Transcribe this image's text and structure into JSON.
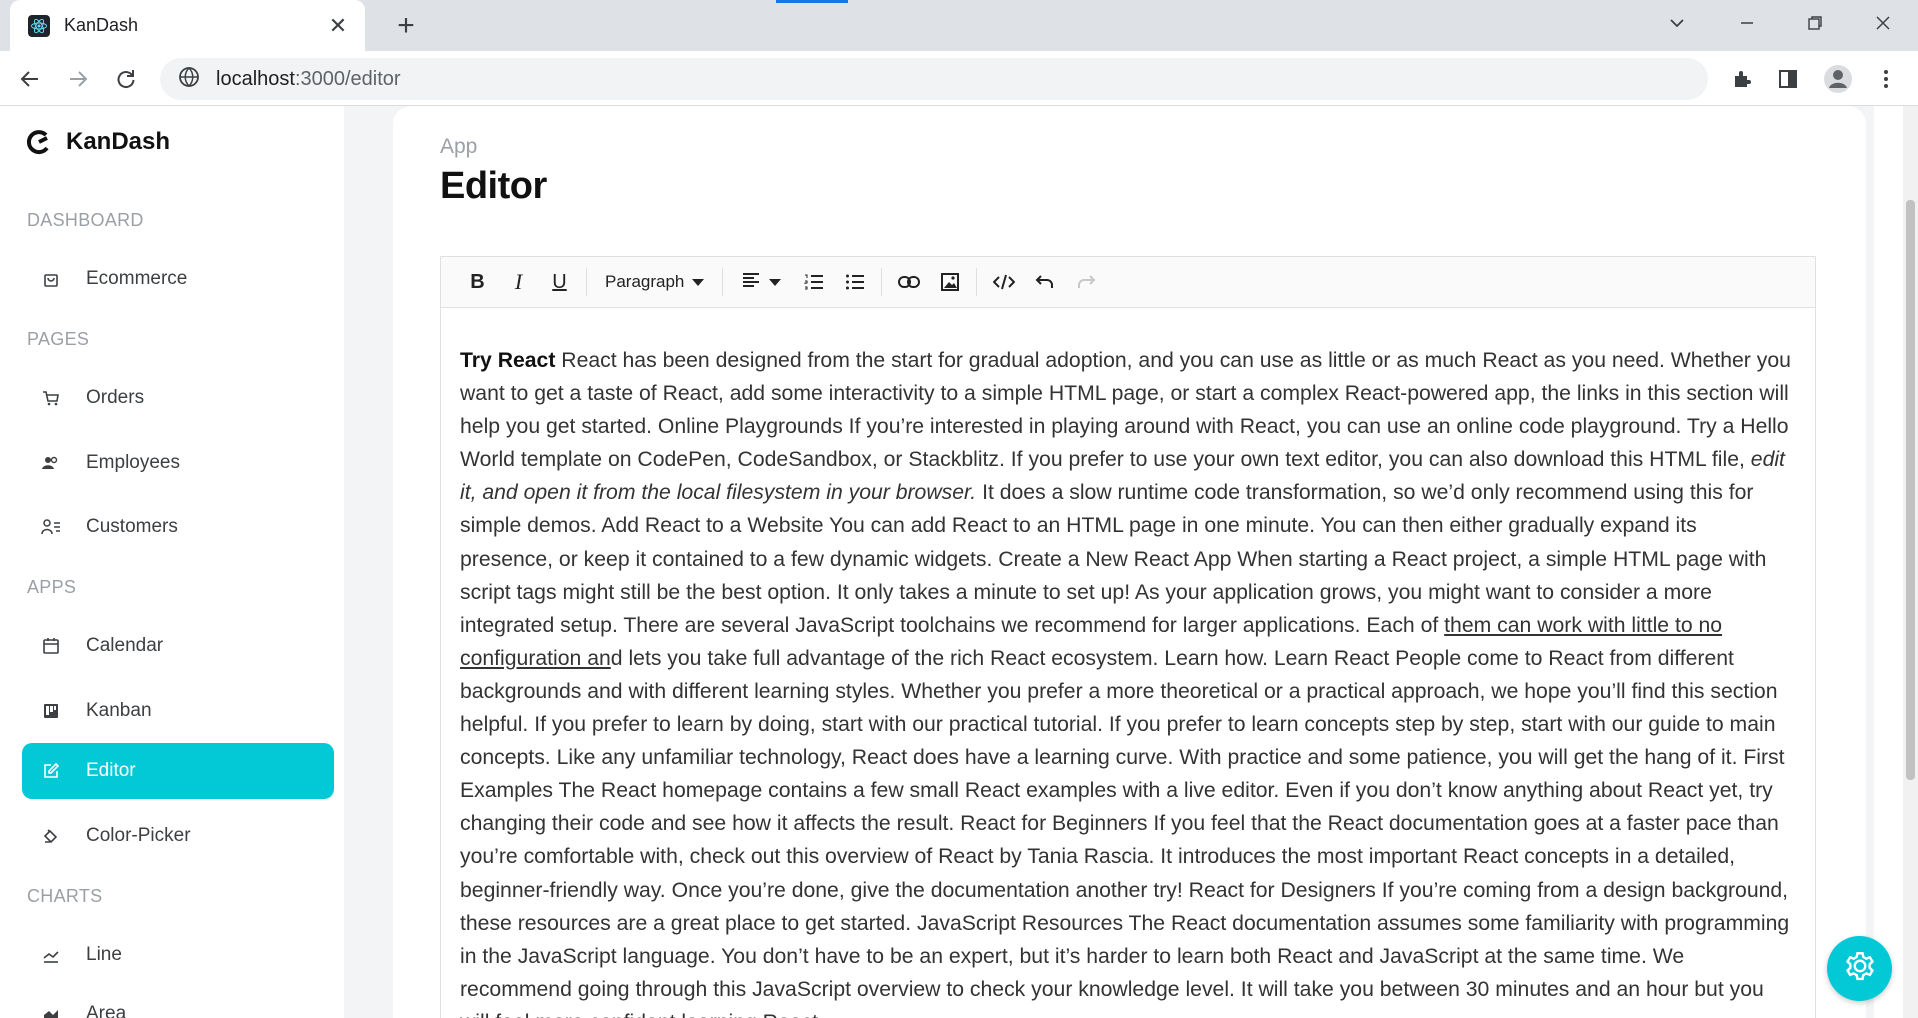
{
  "browser": {
    "tab_title": "KanDash",
    "url_host": "localhost",
    "url_path": ":3000/editor"
  },
  "sidebar": {
    "brand": "KanDash",
    "sections": {
      "dashboard": "DASHBOARD",
      "pages": "PAGES",
      "apps": "APPS",
      "charts": "CHARTS"
    },
    "items": {
      "ecommerce": "Ecommerce",
      "orders": "Orders",
      "employees": "Employees",
      "customers": "Customers",
      "calendar": "Calendar",
      "kanban": "Kanban",
      "editor": "Editor",
      "color_picker": "Color-Picker",
      "line": "Line",
      "area": "Area"
    },
    "active_item": "Editor",
    "accent_color": "#03c9d7"
  },
  "header": {
    "category": "App",
    "title": "Editor"
  },
  "editor": {
    "toolbar": {
      "bold": "B",
      "italic": "I",
      "underline": "U",
      "format": "Paragraph"
    },
    "content": {
      "heading": "Try React",
      "p1": " React has been designed from the start for gradual adoption, and you can use as little or as much React as you need. Whether you want to get a taste of React, add some interactivity to a simple HTML page, or start a complex React-powered app, the links in this section will help you get started. Online Playgrounds If you’re interested in playing around with React, you can use an online code playground. Try a Hello World template on CodePen, CodeSandbox, or Stackblitz. If you prefer to use your own text editor, you can also download this HTML file, ",
      "p1_italic": "edit it, and open it from the local filesystem in your browser.",
      "p2": " It does a slow runtime code transformation, so we’d only recommend using this for simple demos. Add React to a Website You can add React to an HTML page in one minute. You can then either gradually expand its presence, or keep it contained to a few dynamic widgets. Create a New React App When starting a React project, a simple HTML page with script tags might still be the best option. It only takes a minute to set up! As your application grows, you might want to consider a more integrated setup. There are several JavaScript toolchains we recommend for larger applications. Each of ",
      "p2_underline": "them can work with little to no configuration an",
      "p3": "d lets you take full advantage of the rich React ecosystem. Learn how. Learn React People come to React from different backgrounds and with different learning styles. Whether you prefer a more theoretical or a practical approach, we hope you’ll find this section helpful. If you prefer to learn by doing, start with our practical tutorial. If you prefer to learn concepts step by step, start with our guide to main concepts. Like any unfamiliar technology, React does have a learning curve. With practice and some patience, you will get the hang of it. First Examples The React homepage contains a few small React examples with a live editor. Even if you don’t know anything about React yet, try changing their code and see how it affects the result. React for Beginners If you feel that the React documentation goes at a faster pace than you’re comfortable with, check out this overview of React by Tania Rascia. It introduces the most important React concepts in a detailed, beginner-friendly way. Once you’re done, give the documentation another try! React for Designers If you’re coming from a design background, these resources are a great place to get started. JavaScript Resources The React documentation assumes some familiarity with programming in the JavaScript language. You don’t have to be an expert, but it’s harder to learn both React and JavaScript at the same time. We recommend going through this JavaScript overview to check your knowledge level. It will take you between 30 minutes and an hour but you will feel more confident learning React."
    }
  },
  "icons": {
    "settings": "gear-icon"
  }
}
